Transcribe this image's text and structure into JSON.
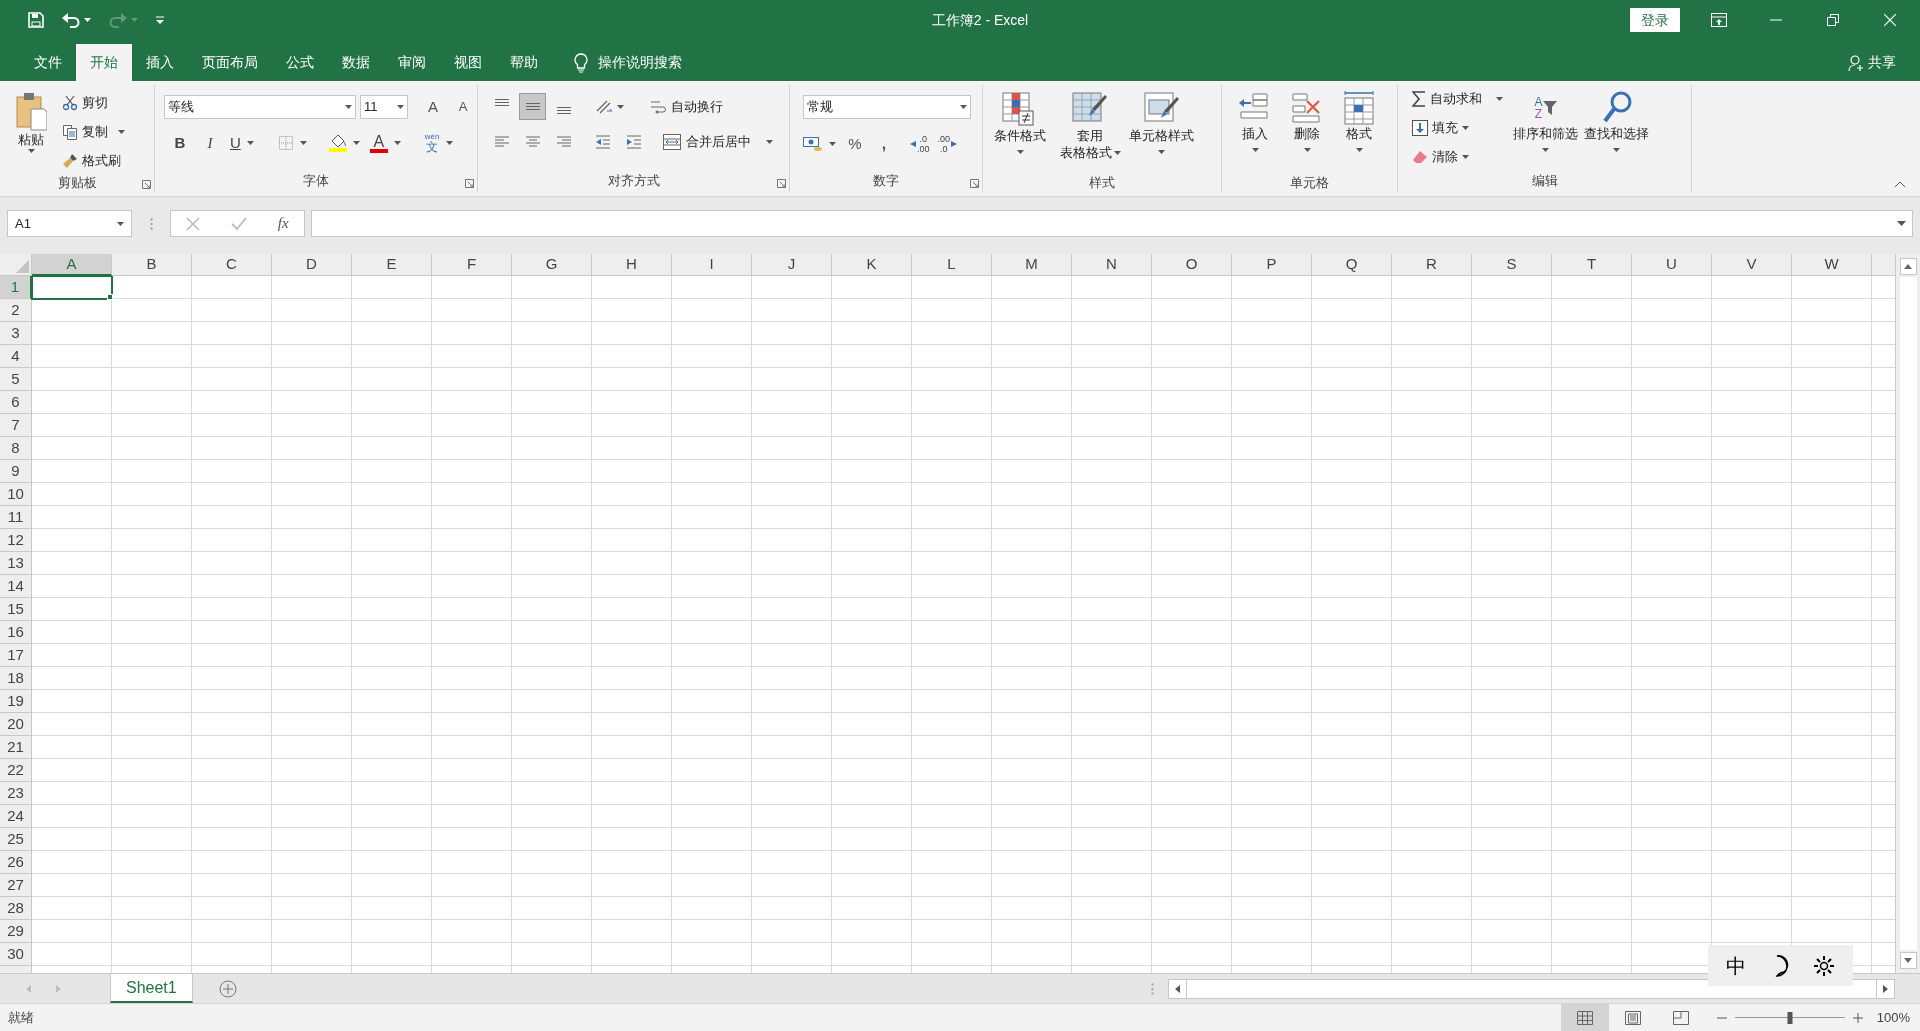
{
  "quick_access": {
    "redo_disabled": true
  },
  "window": {
    "title": "工作簿2 - Excel",
    "sign_in": "登录"
  },
  "tabs": [
    {
      "label": "文件",
      "selected": false
    },
    {
      "label": "开始",
      "selected": true
    },
    {
      "label": "插入",
      "selected": false
    },
    {
      "label": "页面布局",
      "selected": false
    },
    {
      "label": "公式",
      "selected": false
    },
    {
      "label": "数据",
      "selected": false
    },
    {
      "label": "审阅",
      "selected": false
    },
    {
      "label": "视图",
      "selected": false
    },
    {
      "label": "帮助",
      "selected": false
    }
  ],
  "tell_me": "操作说明搜索",
  "share": "共享",
  "clipboard": {
    "title": "剪贴板",
    "paste": "粘贴",
    "cut": "剪切",
    "copy": "复制",
    "format_painter": "格式刷"
  },
  "font": {
    "title": "字体",
    "font_name": "等线",
    "font_size": "11",
    "grow_glyph": "A",
    "shrink_glyph": "A",
    "bold": "B",
    "italic": "I",
    "underline": "U",
    "font_color_glyph": "A",
    "phonetic_glyph": "wén",
    "phonetic_char": "文"
  },
  "alignment": {
    "title": "对齐方式",
    "vertical_align": [
      {
        "selected": false
      },
      {
        "selected": true
      },
      {
        "selected": false
      }
    ],
    "wrap_text": "自动换行",
    "merge_center": "合并后居中"
  },
  "number": {
    "title": "数字",
    "format": "常规",
    "percent": "%",
    "comma": ",",
    "increase_decimal": [
      ".0",
      ".00"
    ],
    "decrease_decimal": [
      ".00",
      ".0"
    ]
  },
  "styles": {
    "title": "样式",
    "buttons": [
      {
        "kind": "conditional",
        "lines": [
          "条件格式"
        ]
      },
      {
        "kind": "table",
        "lines": [
          "套用",
          "表格格式"
        ]
      },
      {
        "kind": "cell",
        "lines": [
          "单元格样式"
        ]
      }
    ]
  },
  "cells": {
    "title": "单元格",
    "buttons": [
      {
        "kind": "insert",
        "label": "插入"
      },
      {
        "kind": "delete",
        "label": "删除"
      },
      {
        "kind": "format",
        "label": "格式"
      }
    ]
  },
  "editing": {
    "title": "编辑",
    "autosum": "自动求和",
    "fill": "填充",
    "clear": "清除",
    "sort": "排序和筛选",
    "sort_letters": [
      "A",
      "Z"
    ],
    "find": "查找和选择"
  },
  "formula_bar": {
    "name_box": "A1",
    "function_glyph": "fx"
  },
  "columns": [
    {
      "label": "A",
      "selected": true
    },
    {
      "label": "B",
      "selected": false
    },
    {
      "label": "C",
      "selected": false
    },
    {
      "label": "D",
      "selected": false
    },
    {
      "label": "E",
      "selected": false
    },
    {
      "label": "F",
      "selected": false
    },
    {
      "label": "G",
      "selected": false
    },
    {
      "label": "H",
      "selected": false
    },
    {
      "label": "I",
      "selected": false
    },
    {
      "label": "J",
      "selected": false
    },
    {
      "label": "K",
      "selected": false
    },
    {
      "label": "L",
      "selected": false
    },
    {
      "label": "M",
      "selected": false
    },
    {
      "label": "N",
      "selected": false
    },
    {
      "label": "O",
      "selected": false
    },
    {
      "label": "P",
      "selected": false
    },
    {
      "label": "Q",
      "selected": false
    },
    {
      "label": "R",
      "selected": false
    },
    {
      "label": "S",
      "selected": false
    },
    {
      "label": "T",
      "selected": false
    },
    {
      "label": "U",
      "selected": false
    },
    {
      "label": "V",
      "selected": false
    },
    {
      "label": "W",
      "selected": false
    }
  ],
  "rows": [
    {
      "label": "1",
      "selected": true
    },
    {
      "label": "2",
      "selected": false
    },
    {
      "label": "3",
      "selected": false
    },
    {
      "label": "4",
      "selected": false
    },
    {
      "label": "5",
      "selected": false
    },
    {
      "label": "6",
      "selected": false
    },
    {
      "label": "7",
      "selected": false
    },
    {
      "label": "8",
      "selected": false
    },
    {
      "label": "9",
      "selected": false
    },
    {
      "label": "10",
      "selected": false
    },
    {
      "label": "11",
      "selected": false
    },
    {
      "label": "12",
      "selected": false
    },
    {
      "label": "13",
      "selected": false
    },
    {
      "label": "14",
      "selected": false
    },
    {
      "label": "15",
      "selected": false
    },
    {
      "label": "16",
      "selected": false
    },
    {
      "label": "17",
      "selected": false
    },
    {
      "label": "18",
      "selected": false
    },
    {
      "label": "19",
      "selected": false
    },
    {
      "label": "20",
      "selected": false
    },
    {
      "label": "21",
      "selected": false
    },
    {
      "label": "22",
      "selected": false
    },
    {
      "label": "23",
      "selected": false
    },
    {
      "label": "24",
      "selected": false
    },
    {
      "label": "25",
      "selected": false
    },
    {
      "label": "26",
      "selected": false
    },
    {
      "label": "27",
      "selected": false
    },
    {
      "label": "28",
      "selected": false
    },
    {
      "label": "29",
      "selected": false
    },
    {
      "label": "30",
      "selected": false
    }
  ],
  "ime_toolbar": {
    "mode": "中"
  },
  "sheet_tabs": [
    {
      "label": "Sheet1",
      "selected": true
    }
  ],
  "status_bar": {
    "status": "就绪",
    "views": [
      {
        "selected": true
      },
      {
        "selected": false
      },
      {
        "selected": false
      }
    ],
    "zoom_slider": {
      "level": 0.5
    },
    "zoom": "100%"
  }
}
